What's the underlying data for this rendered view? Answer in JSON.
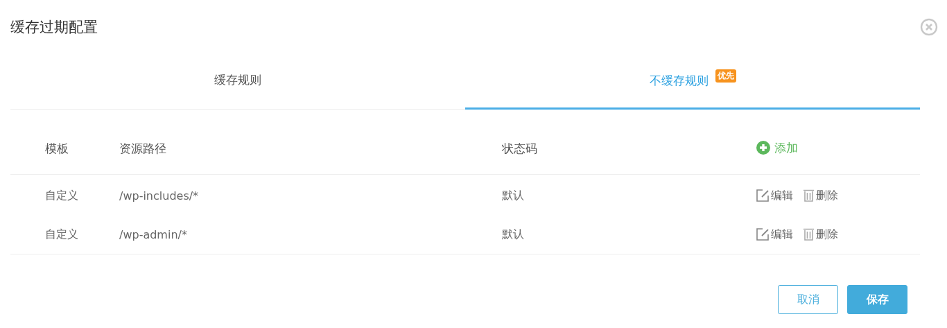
{
  "dialog": {
    "title": "缓存过期配置"
  },
  "tabs": [
    {
      "label": "缓存规则",
      "selected": false
    },
    {
      "label": "不缓存规则",
      "selected": true,
      "badge": "优先"
    }
  ],
  "table": {
    "columns": [
      "模板",
      "资源路径",
      "状态码"
    ],
    "add_action": "添加",
    "rows": [
      {
        "template": "自定义",
        "path": "/wp-includes/*",
        "status_code": "默认",
        "actions": [
          "编辑",
          "删除"
        ]
      },
      {
        "template": "自定义",
        "path": "/wp-admin/*",
        "status_code": "默认",
        "actions": [
          "编辑",
          "删除"
        ]
      }
    ]
  },
  "buttons": [
    {
      "label": "取消",
      "kind": "secondary"
    },
    {
      "label": "保存",
      "kind": "primary"
    }
  ]
}
